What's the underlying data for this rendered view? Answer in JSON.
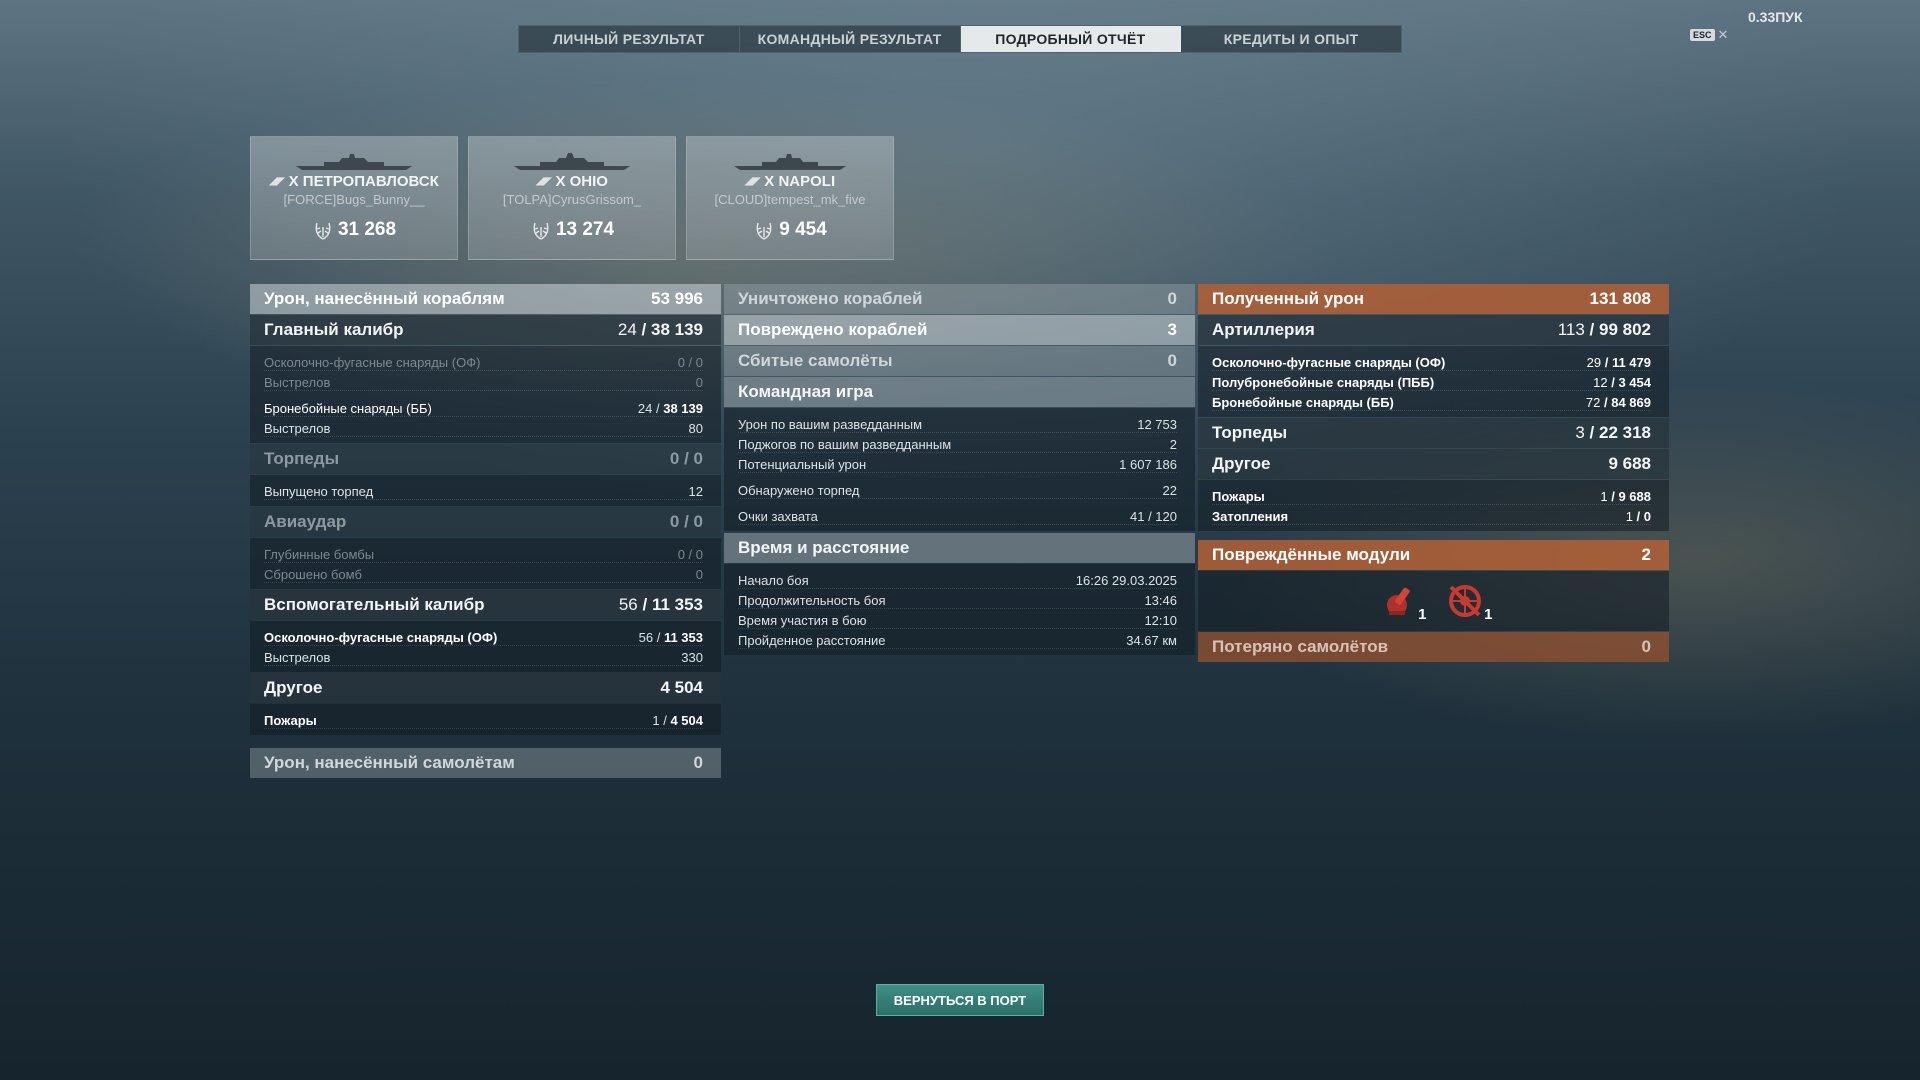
{
  "version": "0.33ПУК",
  "esc_label": "ESC",
  "tabs": [
    {
      "label": "ЛИЧНЫЙ РЕЗУЛЬТАТ"
    },
    {
      "label": "КОМАНДНЫЙ РЕЗУЛЬТАТ"
    },
    {
      "label": "ПОДРОБНЫЙ ОТЧЁТ"
    },
    {
      "label": "КРЕДИТЫ И ОПЫТ"
    }
  ],
  "active_tab": 2,
  "cards": [
    {
      "ship": "X ПЕТРОПАВЛОВСК",
      "player": "[FORCE]Bugs_Bunny__",
      "damage": "31 268"
    },
    {
      "ship": "X OHIO",
      "player": "[TOLPA]CyrusGrissom_",
      "damage": "13 274"
    },
    {
      "ship": "X NAPOLI",
      "player": "[CLOUD]tempest_mk_five",
      "damage": "9 454"
    }
  ],
  "left": {
    "damage_ships": {
      "label": "Урон, нанесённый кораблям",
      "value": "53 996"
    },
    "main": {
      "label": "Главный калибр",
      "value_a": "24",
      "value_b": "38 139"
    },
    "he": {
      "label": "Осколочно-фугасные снаряды (ОФ)",
      "a": "0",
      "b": "0"
    },
    "he_shots": {
      "label": "Выстрелов",
      "value": "0"
    },
    "ap": {
      "label": "Бронебойные снаряды (ББ)",
      "a": "24",
      "b": "38 139"
    },
    "ap_shots": {
      "label": "Выстрелов",
      "value": "80"
    },
    "torp": {
      "label": "Торпеды",
      "value": "0 / 0"
    },
    "torp_launched": {
      "label": "Выпущено торпед",
      "value": "12"
    },
    "air": {
      "label": "Авиаудар",
      "value": "0 / 0"
    },
    "depth": {
      "label": "Глубинные бомбы",
      "a": "0",
      "b": "0"
    },
    "bombs": {
      "label": "Сброшено бомб",
      "value": "0"
    },
    "secondary": {
      "label": "Вспомогательный калибр",
      "value_a": "56",
      "value_b": "11 353"
    },
    "sec_he": {
      "label": "Осколочно-фугасные снаряды (ОФ)",
      "a": "56",
      "b": "11 353"
    },
    "sec_shots": {
      "label": "Выстрелов",
      "value": "330"
    },
    "other": {
      "label": "Другое",
      "value": "4 504"
    },
    "fires": {
      "label": "Пожары",
      "a": "1",
      "b": "4 504"
    },
    "planes": {
      "label": "Урон, нанесённый самолётам",
      "value": "0"
    }
  },
  "middle": {
    "destroyed": {
      "label": "Уничтожено кораблей",
      "value": "0"
    },
    "damaged": {
      "label": "Повреждено кораблей",
      "value": "3"
    },
    "shot_planes": {
      "label": "Сбитые самолёты",
      "value": "0"
    },
    "team": {
      "label": "Командная игра"
    },
    "team_rows": [
      {
        "label": "Урон по вашим разведданным",
        "value": "12 753"
      },
      {
        "label": "Поджогов по вашим разведданным",
        "value": "2"
      },
      {
        "label": "Потенциальный урон",
        "value": "1 607 186"
      },
      {
        "label": "Обнаружено торпед",
        "value": "22"
      },
      {
        "label": "Очки захвата",
        "value": "41 / 120"
      }
    ],
    "time": {
      "label": "Время и расстояние"
    },
    "time_rows": [
      {
        "label": "Начало боя",
        "value": "16:26  29.03.2025"
      },
      {
        "label": "Продолжительность боя",
        "value": "13:46"
      },
      {
        "label": "Время участия в бою",
        "value": "12:10"
      },
      {
        "label": "Пройденное расстояние",
        "value": "34.67 км"
      }
    ]
  },
  "right": {
    "received": {
      "label": "Полученный урон",
      "value": "131 808"
    },
    "artillery": {
      "label": "Артиллерия",
      "value_a": "113",
      "value_b": "99 802"
    },
    "he": {
      "label": "Осколочно-фугасные снаряды (ОФ)",
      "a": "29",
      "b": "11 479"
    },
    "sap": {
      "label": "Полубронебойные снаряды (ПББ)",
      "a": "12",
      "b": "3 454"
    },
    "ap": {
      "label": "Бронебойные снаряды (ББ)",
      "a": "72",
      "b": "84 869"
    },
    "torp": {
      "label": "Торпеды",
      "value_a": "3",
      "value_b": "22 318"
    },
    "other": {
      "label": "Другое",
      "value": "9 688"
    },
    "fires": {
      "label": "Пожары",
      "a": "1",
      "b": "9 688"
    },
    "flood": {
      "label": "Затопления",
      "a": "1",
      "b": "0"
    },
    "modules": {
      "label": "Повреждённые модули",
      "value": "2"
    },
    "module_counts": [
      "1",
      "1"
    ],
    "lost_planes": {
      "label": "Потеряно самолётов",
      "value": "0"
    }
  },
  "return_button": "ВЕРНУТЬСЯ В ПОРТ"
}
